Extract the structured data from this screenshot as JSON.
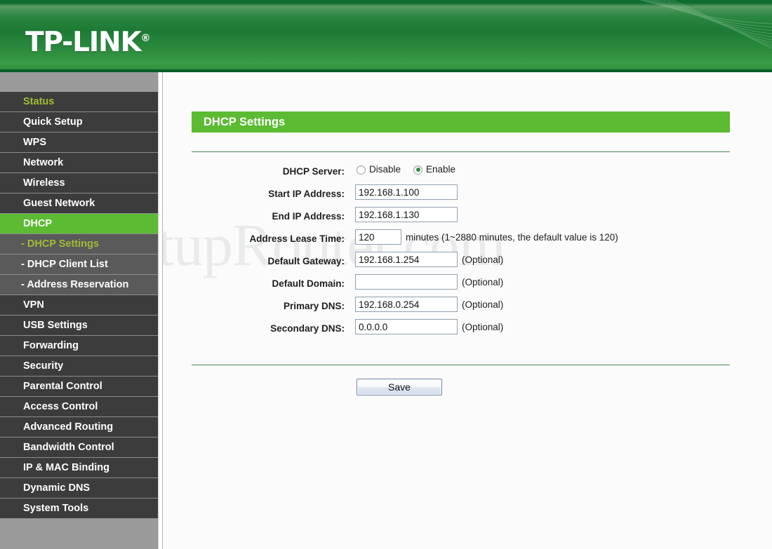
{
  "header": {
    "brand": "TP-LINK",
    "trademark": "®"
  },
  "watermark": {
    "text": "SetupRouter.com"
  },
  "sidebar": {
    "items": [
      {
        "label": "Status",
        "type": "top",
        "state": "visited"
      },
      {
        "label": "Quick Setup",
        "type": "top",
        "state": "normal"
      },
      {
        "label": "WPS",
        "type": "top",
        "state": "normal"
      },
      {
        "label": "Network",
        "type": "top",
        "state": "normal"
      },
      {
        "label": "Wireless",
        "type": "top",
        "state": "normal"
      },
      {
        "label": "Guest Network",
        "type": "top",
        "state": "normal"
      },
      {
        "label": "DHCP",
        "type": "top",
        "state": "active"
      },
      {
        "label": "- DHCP Settings",
        "type": "sub",
        "state": "visited"
      },
      {
        "label": "- DHCP Client List",
        "type": "sub",
        "state": "normal"
      },
      {
        "label": "- Address Reservation",
        "type": "sub",
        "state": "normal"
      },
      {
        "label": "VPN",
        "type": "top",
        "state": "normal"
      },
      {
        "label": "USB Settings",
        "type": "top",
        "state": "normal"
      },
      {
        "label": "Forwarding",
        "type": "top",
        "state": "normal"
      },
      {
        "label": "Security",
        "type": "top",
        "state": "normal"
      },
      {
        "label": "Parental Control",
        "type": "top",
        "state": "normal"
      },
      {
        "label": "Access Control",
        "type": "top",
        "state": "normal"
      },
      {
        "label": "Advanced Routing",
        "type": "top",
        "state": "normal"
      },
      {
        "label": "Bandwidth Control",
        "type": "top",
        "state": "normal"
      },
      {
        "label": "IP & MAC Binding",
        "type": "top",
        "state": "normal"
      },
      {
        "label": "Dynamic DNS",
        "type": "top",
        "state": "normal"
      },
      {
        "label": "System Tools",
        "type": "top",
        "state": "normal"
      }
    ]
  },
  "main": {
    "panel_title": "DHCP Settings",
    "dhcp_server": {
      "label": "DHCP Server:",
      "options": [
        {
          "label": "Disable",
          "selected": false
        },
        {
          "label": "Enable",
          "selected": true
        }
      ]
    },
    "fields": [
      {
        "label": "Start IP Address:",
        "value": "192.168.1.100",
        "hint": "",
        "short": false
      },
      {
        "label": "End IP Address:",
        "value": "192.168.1.130",
        "hint": "",
        "short": false
      },
      {
        "label": "Address Lease Time:",
        "value": "120",
        "hint": "minutes (1~2880 minutes, the default value is 120)",
        "short": true
      },
      {
        "label": "Default Gateway:",
        "value": "192.168.1.254",
        "hint": "(Optional)",
        "short": false
      },
      {
        "label": "Default Domain:",
        "value": "",
        "hint": "(Optional)",
        "short": false
      },
      {
        "label": "Primary DNS:",
        "value": "192.168.0.254",
        "hint": "(Optional)",
        "short": false
      },
      {
        "label": "Secondary DNS:",
        "value": "0.0.0.0",
        "hint": "(Optional)",
        "short": false
      }
    ],
    "save_label": "Save"
  },
  "colors": {
    "brand_green": "#5cbb32",
    "header_green": "#1c7a35",
    "sidebar_item": "#3c3c3c",
    "sidebar_sub": "#5a5a5a",
    "olive_text": "#9fbd36"
  }
}
